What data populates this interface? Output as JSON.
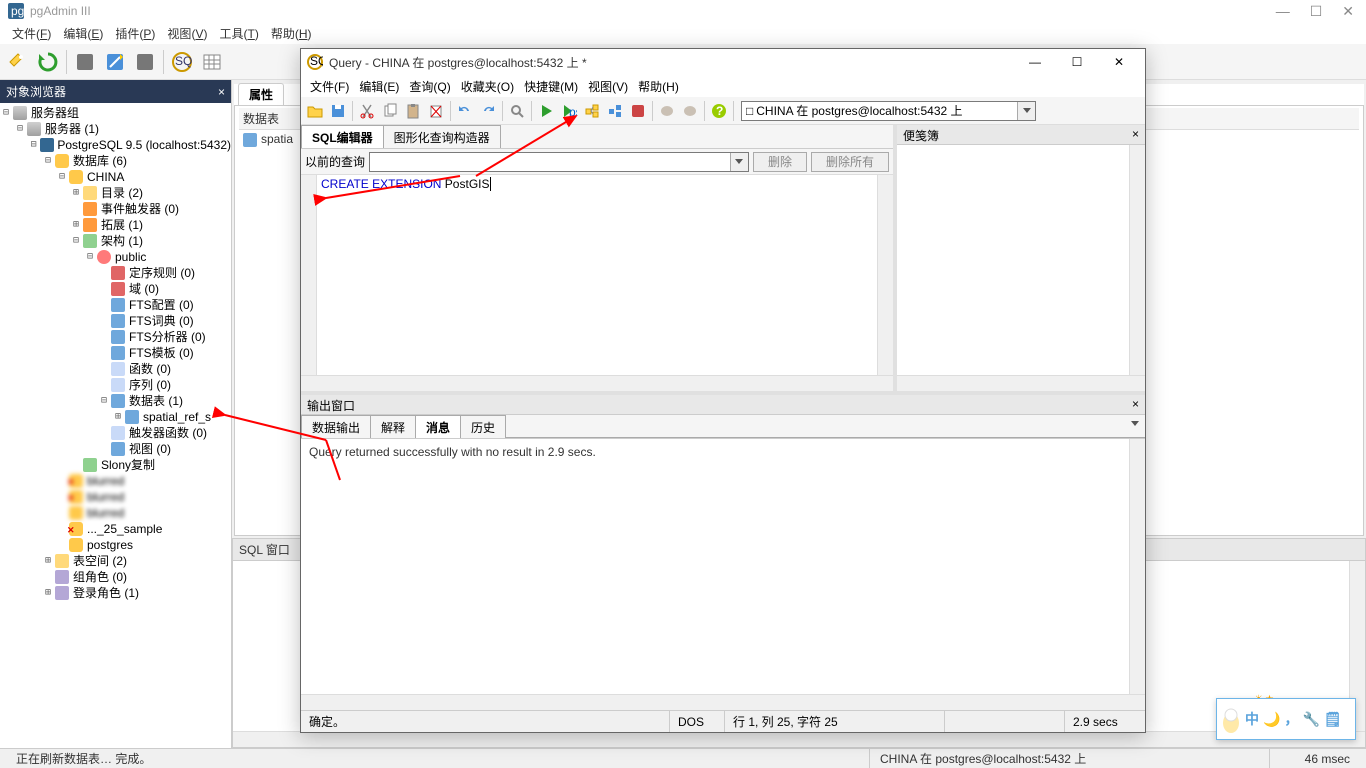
{
  "app": {
    "title": "pgAdmin III"
  },
  "main_menu": [
    {
      "l": "文件",
      "m": "F"
    },
    {
      "l": "编辑",
      "m": "E"
    },
    {
      "l": "插件",
      "m": "P"
    },
    {
      "l": "视图",
      "m": "V"
    },
    {
      "l": "工具",
      "m": "T"
    },
    {
      "l": "帮助",
      "m": "H"
    }
  ],
  "object_browser": {
    "title": "对象浏览器",
    "root": "服务器组",
    "server_group": "服务器 (1)",
    "server": "PostgreSQL 9.5 (localhost:5432)",
    "databases": "数据库 (6)",
    "db_china": "CHINA",
    "nodes": [
      {
        "l": "目录 (2)",
        "ic": "i-cat"
      },
      {
        "l": "事件触发器 (0)",
        "ic": "i-ext"
      },
      {
        "l": "拓展 (1)",
        "ic": "i-ext"
      },
      {
        "l": "架构 (1)",
        "ic": "i-schema"
      }
    ],
    "public": "public",
    "public_children": [
      {
        "l": "定序规则 (0)",
        "ic": "i-col"
      },
      {
        "l": "域 (0)",
        "ic": "i-col"
      },
      {
        "l": "FTS配置 (0)",
        "ic": "i-tbl"
      },
      {
        "l": "FTS词典 (0)",
        "ic": "i-tbl"
      },
      {
        "l": "FTS分析器 (0)",
        "ic": "i-tbl"
      },
      {
        "l": "FTS模板 (0)",
        "ic": "i-tbl"
      },
      {
        "l": "函数 (0)",
        "ic": "i-fn"
      },
      {
        "l": "序列 (0)",
        "ic": "i-fn"
      }
    ],
    "tables": "数据表 (1)",
    "spatial_table": "spatial_ref_s",
    "trigger_fn": "触发器函数 (0)",
    "views": "视图 (0)",
    "slony": "Slony复制",
    "blurred1": "",
    "blurred2": "",
    "sample": "..._25_sample",
    "postgres_db": "postgres",
    "tablespaces": "表空间 (2)",
    "group_roles": "组角色 (0)",
    "login_roles": "登录角色 (1)"
  },
  "props": {
    "tab": "属性",
    "col_header": "数据表",
    "row1": "spatia"
  },
  "sql_pane": {
    "title": "SQL 窗口"
  },
  "status": {
    "msg": "正在刷新数据表… 完成。",
    "conn": "CHINA 在  postgres@localhost:5432 上",
    "time": "46 msec"
  },
  "query_window": {
    "title": "Query - CHINA 在  postgres@localhost:5432 上 *",
    "menu": [
      {
        "l": "文件",
        "m": "F"
      },
      {
        "l": "编辑",
        "m": "E"
      },
      {
        "l": "查询",
        "m": "Q"
      },
      {
        "l": "收藏夹",
        "m": "O"
      },
      {
        "l": "快捷键",
        "m": "M"
      },
      {
        "l": "视图",
        "m": "V"
      },
      {
        "l": "帮助",
        "m": "H"
      }
    ],
    "conn_combo_icon": "□",
    "conn_combo": "CHINA 在  postgres@localhost:5432 上",
    "editor_tabs": [
      "SQL编辑器",
      "图形化查询构造器"
    ],
    "prev_label": "以前的查询",
    "btn_delete": "删除",
    "btn_delete_all": "删除所有",
    "sql_kw": "CREATE EXTENSION",
    "sql_rest": " PostGIS",
    "scratch_title": "便笺簿",
    "output_title": "输出窗口",
    "output_tabs": [
      "数据输出",
      "解释",
      "消息",
      "历史"
    ],
    "output_active": 2,
    "output_msg": "Query returned successfully with no result in 2.9 secs.",
    "q_status": {
      "ok": "确定。",
      "enc": "DOS",
      "pos": "行 1, 列 25, 字符 25",
      "rows": "",
      "time": "2.9 secs"
    }
  },
  "ime": {
    "text": "中",
    "moon": "🌙",
    "comma": "，",
    "wrench": "🔧",
    "note": "🗒"
  }
}
